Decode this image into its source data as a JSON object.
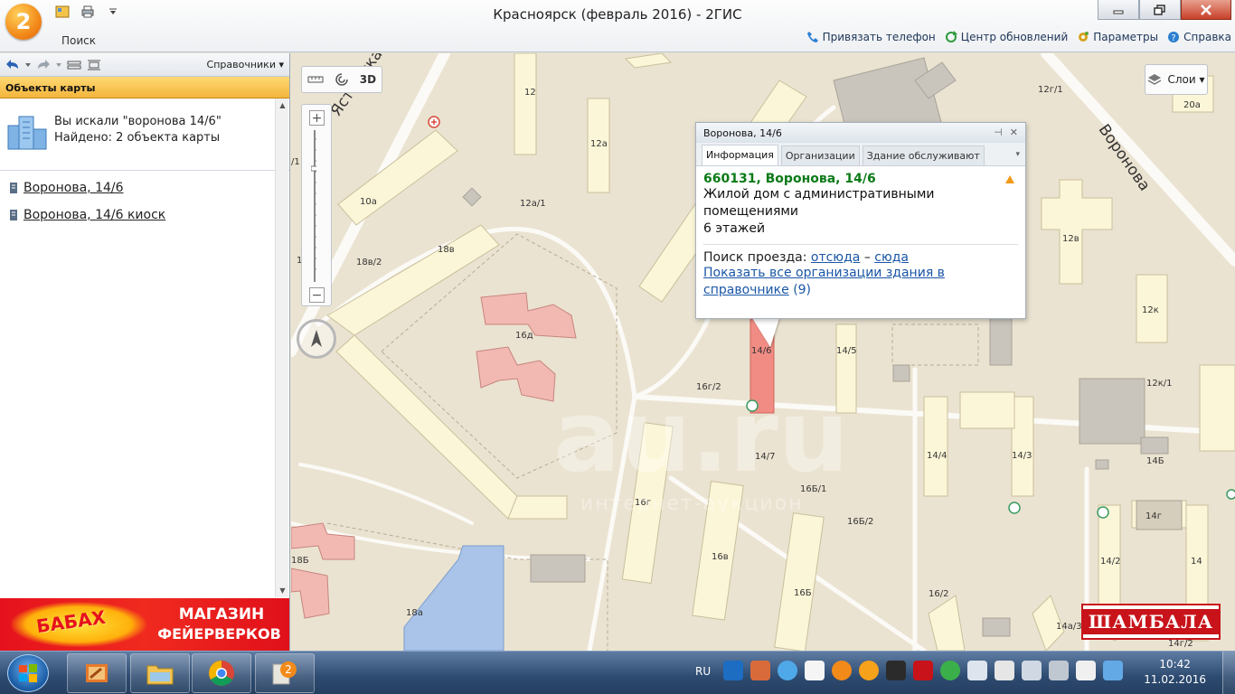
{
  "window": {
    "title": "Красноярск (февраль 2016) - 2ГИС",
    "logo_text": "2",
    "search_label": "Поиск"
  },
  "top_links": [
    {
      "label": "Привязать телефон",
      "icon": "phone-icon"
    },
    {
      "label": "Центр обновлений",
      "icon": "refresh-icon"
    },
    {
      "label": "Параметры",
      "icon": "gear-icon"
    },
    {
      "label": "Справка",
      "icon": "help-icon"
    }
  ],
  "left_panel": {
    "directory_dropdown": "Справочники ▾",
    "section_header": "Объекты карты",
    "search_query": "Вы искали \"воронова 14/6\"",
    "search_count": "Найдено: 2 объекта карты",
    "results": [
      {
        "label": "Воронова, 14/6"
      },
      {
        "label": "Воронова, 14/6 киоск"
      }
    ],
    "banner": {
      "brand": "БАБАХ",
      "line1": "МАГАЗИН",
      "line2": "ФЕЙЕРВЕРКОВ"
    }
  },
  "map": {
    "threed_label": "3D",
    "layers_label": "Слои ▾",
    "street_labels": [
      {
        "text": "Ястынская"
      },
      {
        "text": "Воронова"
      }
    ],
    "building_labels": [
      "12",
      "12а",
      "12а/1",
      "10а",
      "18в",
      "18в/2",
      "16д",
      "14/6",
      "14/5",
      "16г/2",
      "14/7",
      "16Б/1",
      "16Б/2",
      "16г",
      "16в",
      "16Б",
      "16/2",
      "18Б",
      "18а",
      "12г/1",
      "20а",
      "12в",
      "12к",
      "12к/1",
      "14/4",
      "14/3",
      "14Б",
      "14г",
      "14/2",
      "14",
      "14а/3",
      "14г/2",
      "/1",
      "1"
    ],
    "watermark_main": "au.ru",
    "watermark_sub": "интернет-аукцион",
    "banner_right": "ШАМБАЛА"
  },
  "popup": {
    "title": "Воронова, 14/6",
    "tabs": [
      {
        "label": "Информация",
        "active": true
      },
      {
        "label": "Организации",
        "active": false
      },
      {
        "label": "Здание обслуживают",
        "active": false
      }
    ],
    "address": "660131, Воронова, 14/6",
    "description_line1": "Жилой дом с административными",
    "description_line2": "помещениями",
    "floors": "6 этажей",
    "route_label": "Поиск проезда:",
    "route_from": "отсюда",
    "route_dash": "–",
    "route_to": "сюда",
    "all_orgs_link": "Показать все организации здания в справочнике",
    "all_orgs_count": "(9)"
  },
  "taskbar": {
    "language": "RU",
    "time": "10:42",
    "date": "11.02.2016"
  },
  "colors": {
    "accent_orange": "#f3b53c",
    "link_blue": "#1a56a6",
    "address_green": "#0b7a17",
    "highlight_building": "#f08c84",
    "map_bg": "#ebe3d1"
  }
}
